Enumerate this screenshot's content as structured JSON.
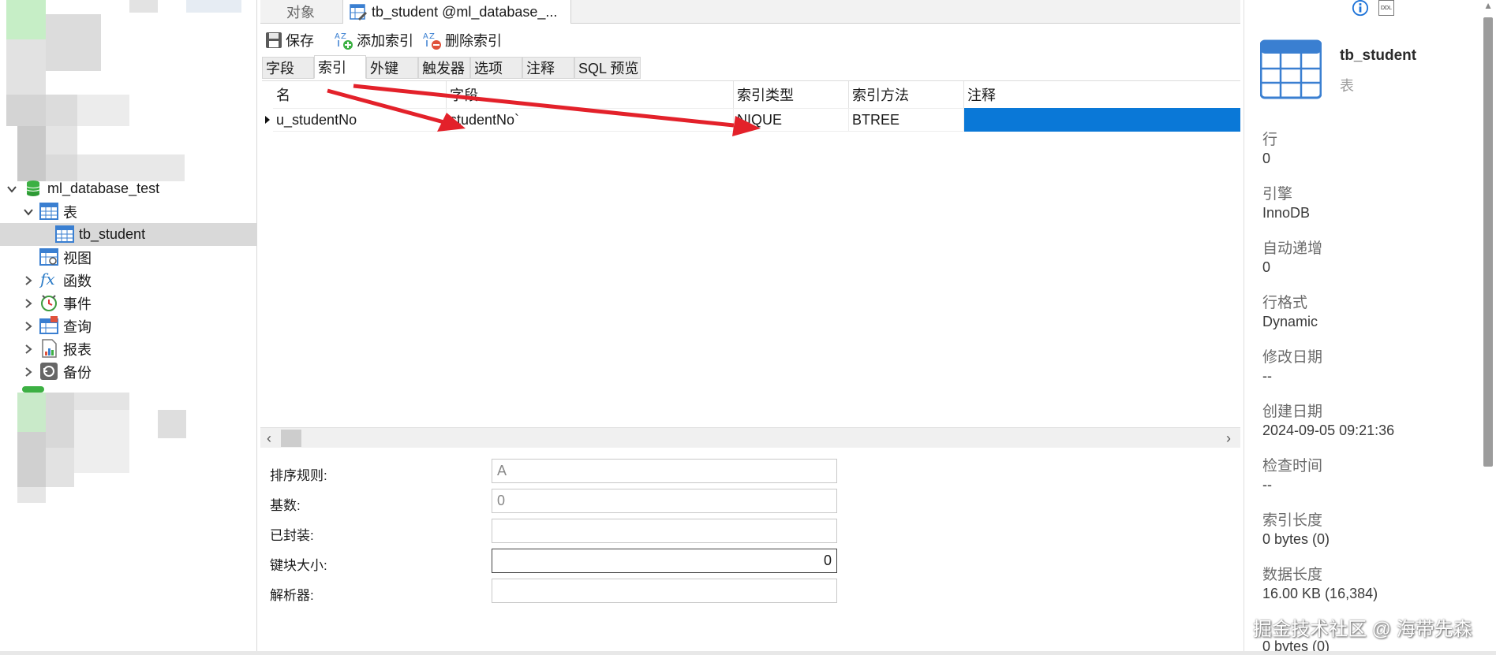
{
  "tree": {
    "database": "ml_database_test",
    "tables_folder": "表",
    "selected_table": "tb_student",
    "views": "视图",
    "functions": "函数",
    "events": "事件",
    "queries": "查询",
    "reports": "报表",
    "backups": "备份"
  },
  "tabs": {
    "objects": "对象",
    "active": "tb_student @ml_database_..."
  },
  "toolbar": {
    "save": "保存",
    "add_index": "添加索引",
    "delete_index": "删除索引"
  },
  "subtabs": [
    "字段",
    "索引",
    "外键",
    "触发器",
    "选项",
    "注释",
    "SQL 预览"
  ],
  "subtabs_active": "索引",
  "grid": {
    "columns": [
      "名",
      "字段",
      "索引类型",
      "索引方法",
      "注释"
    ],
    "rows": [
      {
        "name": "u_studentNo",
        "field": "studentNo`",
        "type": "NIQUE",
        "method": "BTREE",
        "comment": ""
      }
    ]
  },
  "props": {
    "collation_label": "排序规则:",
    "collation_value": "A",
    "cardinality_label": "基数:",
    "cardinality_value": "0",
    "packed_label": "已封装:",
    "packed_value": "",
    "key_block_label": "键块大小:",
    "key_block_value": "0",
    "parser_label": "解析器:",
    "parser_value": ""
  },
  "info": {
    "ddl_badge": "DDL",
    "table_name": "tb_student",
    "table_type": "表",
    "rows_label": "行",
    "rows_value": "0",
    "engine_label": "引擎",
    "engine_value": "InnoDB",
    "auto_inc_label": "自动递增",
    "auto_inc_value": "0",
    "row_format_label": "行格式",
    "row_format_value": "Dynamic",
    "modified_label": "修改日期",
    "modified_value": "--",
    "created_label": "创建日期",
    "created_value": "2024-09-05 09:21:36",
    "check_time_label": "检查时间",
    "check_time_value": "--",
    "index_length_label": "索引长度",
    "index_length_value": "0 bytes (0)",
    "data_length_label": "数据长度",
    "data_length_value": "16.00 KB (16,384)",
    "bottom_value": "0 bytes (0)"
  },
  "watermark": "掘金技术社区 @ 海带先森",
  "colors": {
    "selection_blue": "#0a78d7",
    "arrow_red": "#e3212a",
    "db_green": "#3cb043",
    "table_blue": "#3a7fd1"
  }
}
